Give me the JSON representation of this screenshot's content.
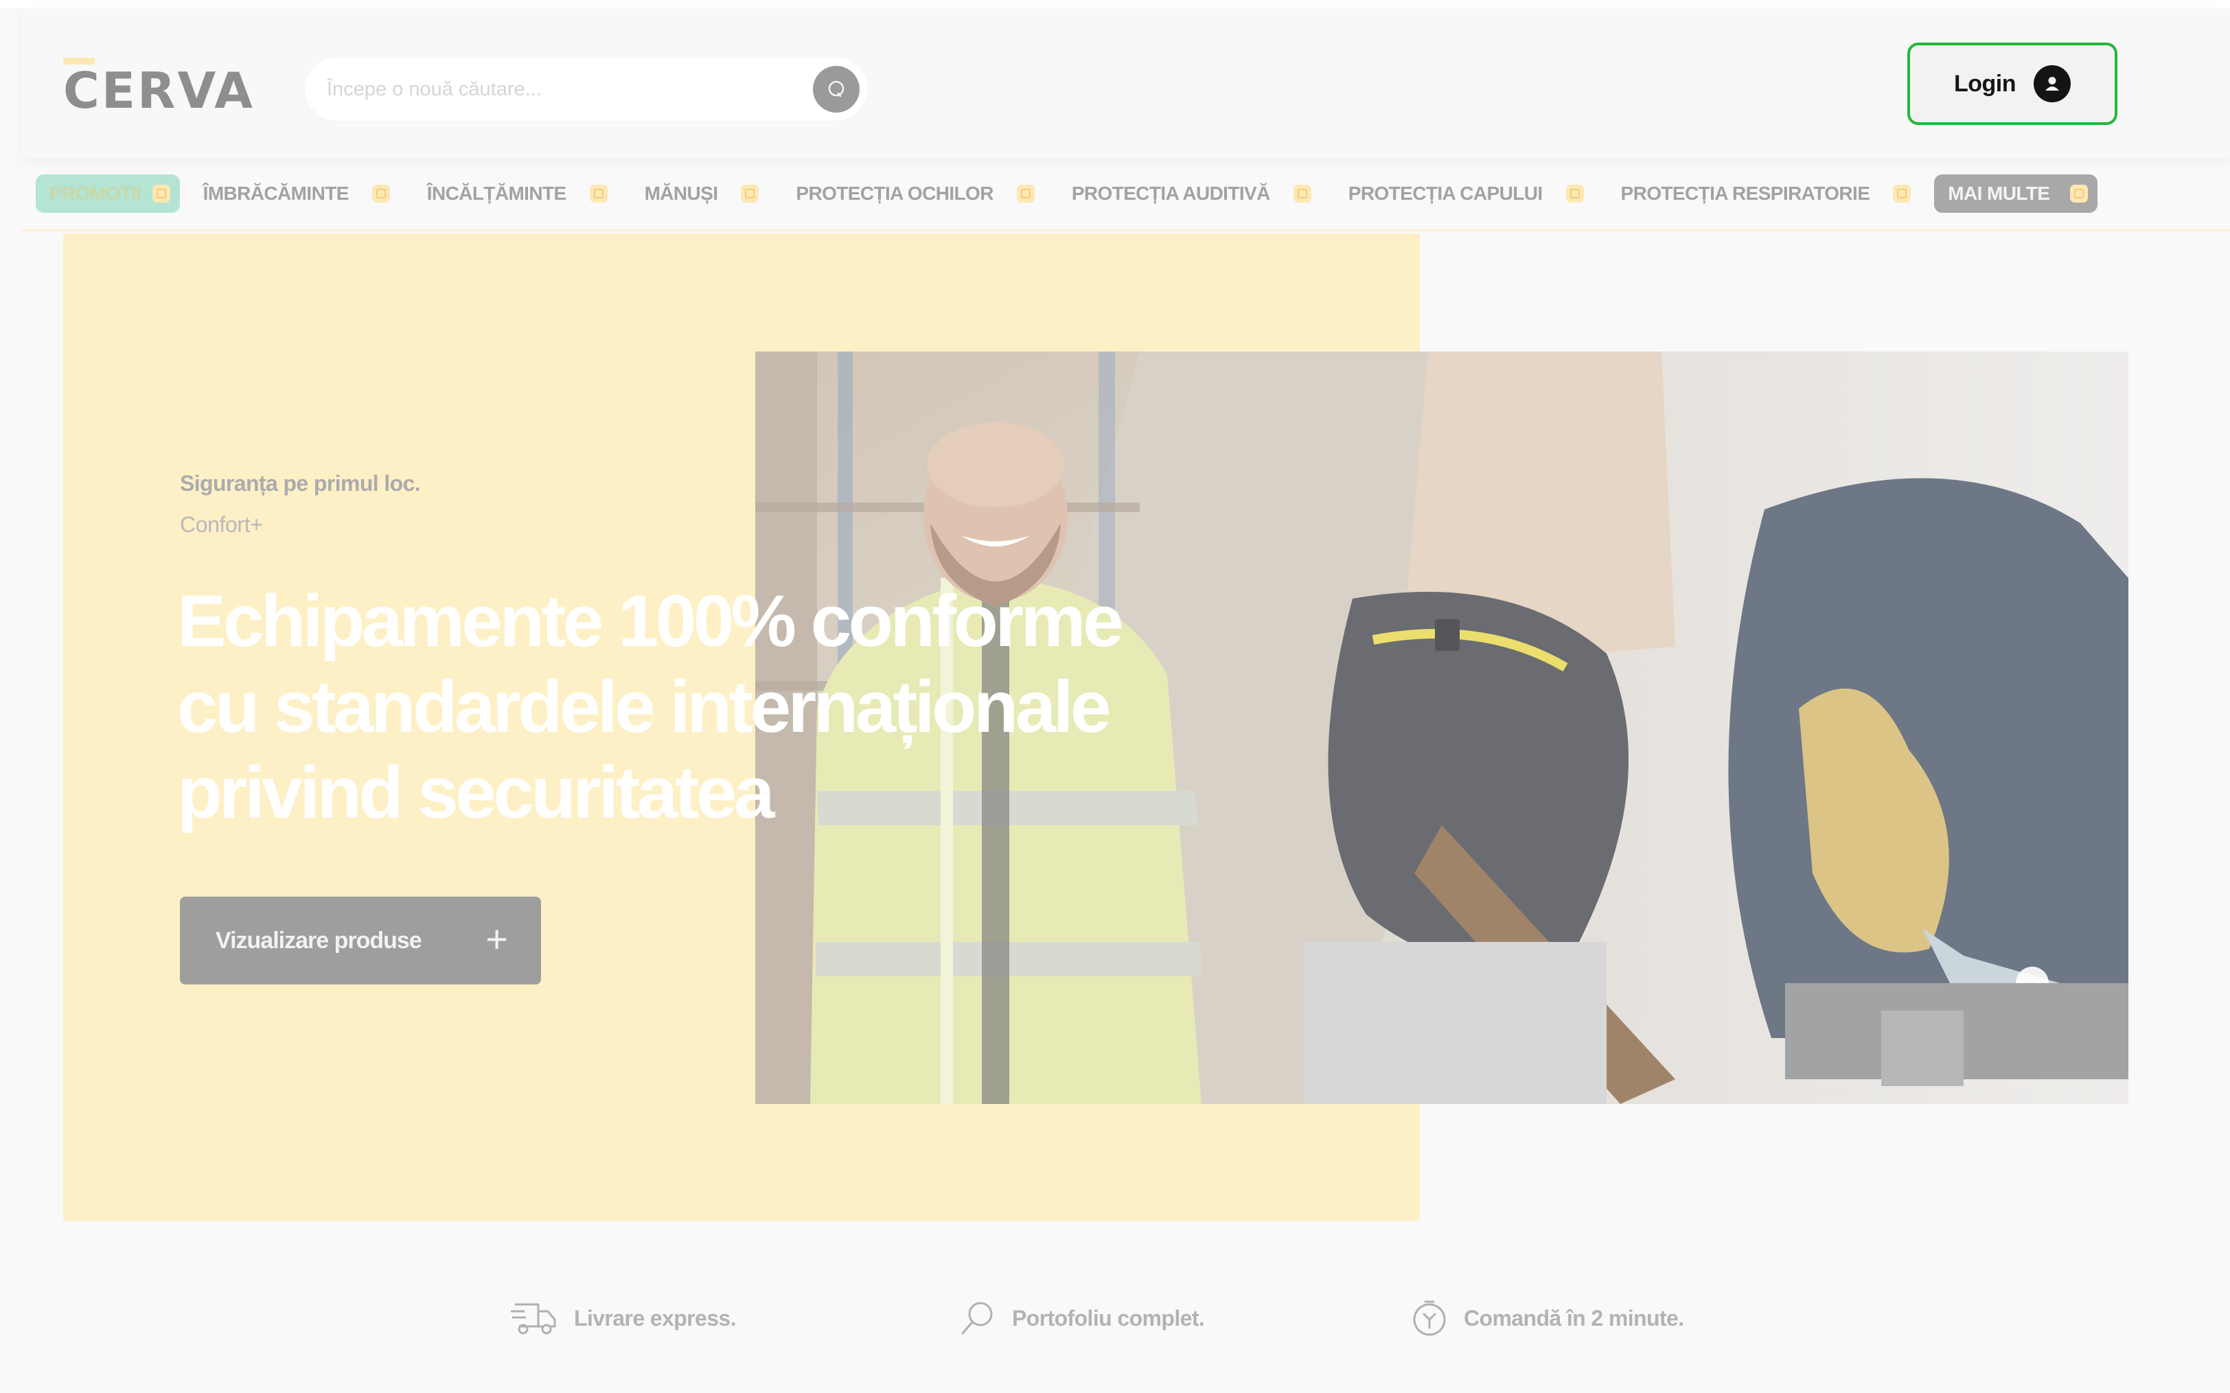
{
  "header": {
    "logo_text": "CERVA",
    "search": {
      "placeholder": "Începe o nouă căutare...",
      "value": ""
    },
    "login_label": "Login"
  },
  "nav": {
    "items": [
      {
        "label": "PROMOTII",
        "variant": "highlight"
      },
      {
        "label": "ÎMBRĂCĂMINTE"
      },
      {
        "label": "ÎNCĂLȚĂMINTE"
      },
      {
        "label": "MĂNUȘI"
      },
      {
        "label": "PROTECȚIA OCHILOR"
      },
      {
        "label": "PROTECȚIA AUDITIVĂ"
      },
      {
        "label": "PROTECȚIA CAPULUI"
      },
      {
        "label": "PROTECȚIA RESPIRATORIE"
      },
      {
        "label": "MAI MULTE",
        "variant": "more"
      }
    ]
  },
  "hero": {
    "kicker": "Siguranța pe primul loc.",
    "sub_kicker": "Confort+",
    "title_lines": [
      "Echipamente 100% conforme",
      "cu standardele internaționale",
      "privind securitatea"
    ],
    "cta_label": "Vizualizare produse",
    "cta_icon": "plus-icon"
  },
  "features": [
    {
      "label": "Livrare express.",
      "icon": "delivery-truck-icon"
    },
    {
      "label": "Portofoliu complet.",
      "icon": "search-icon"
    },
    {
      "label": "Comandă în 2 minute.",
      "icon": "clock-icon"
    }
  ],
  "colors": {
    "accent_yellow": "#fef0c6",
    "login_border": "#22b83a",
    "promo_bg": "#b4e4d4",
    "cta_bg": "#9e9e9e"
  }
}
